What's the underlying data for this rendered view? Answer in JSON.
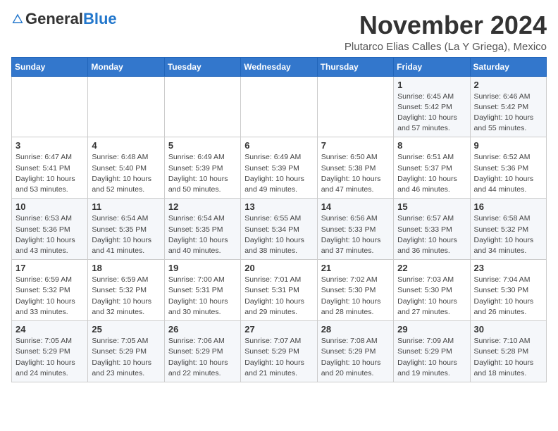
{
  "header": {
    "logo_general": "General",
    "logo_blue": "Blue",
    "month": "November 2024",
    "location": "Plutarco Elias Calles (La Y Griega), Mexico"
  },
  "days_of_week": [
    "Sunday",
    "Monday",
    "Tuesday",
    "Wednesday",
    "Thursday",
    "Friday",
    "Saturday"
  ],
  "weeks": [
    [
      {
        "day": "",
        "info": ""
      },
      {
        "day": "",
        "info": ""
      },
      {
        "day": "",
        "info": ""
      },
      {
        "day": "",
        "info": ""
      },
      {
        "day": "",
        "info": ""
      },
      {
        "day": "1",
        "info": "Sunrise: 6:45 AM\nSunset: 5:42 PM\nDaylight: 10 hours\nand 57 minutes."
      },
      {
        "day": "2",
        "info": "Sunrise: 6:46 AM\nSunset: 5:42 PM\nDaylight: 10 hours\nand 55 minutes."
      }
    ],
    [
      {
        "day": "3",
        "info": "Sunrise: 6:47 AM\nSunset: 5:41 PM\nDaylight: 10 hours\nand 53 minutes."
      },
      {
        "day": "4",
        "info": "Sunrise: 6:48 AM\nSunset: 5:40 PM\nDaylight: 10 hours\nand 52 minutes."
      },
      {
        "day": "5",
        "info": "Sunrise: 6:49 AM\nSunset: 5:39 PM\nDaylight: 10 hours\nand 50 minutes."
      },
      {
        "day": "6",
        "info": "Sunrise: 6:49 AM\nSunset: 5:39 PM\nDaylight: 10 hours\nand 49 minutes."
      },
      {
        "day": "7",
        "info": "Sunrise: 6:50 AM\nSunset: 5:38 PM\nDaylight: 10 hours\nand 47 minutes."
      },
      {
        "day": "8",
        "info": "Sunrise: 6:51 AM\nSunset: 5:37 PM\nDaylight: 10 hours\nand 46 minutes."
      },
      {
        "day": "9",
        "info": "Sunrise: 6:52 AM\nSunset: 5:36 PM\nDaylight: 10 hours\nand 44 minutes."
      }
    ],
    [
      {
        "day": "10",
        "info": "Sunrise: 6:53 AM\nSunset: 5:36 PM\nDaylight: 10 hours\nand 43 minutes."
      },
      {
        "day": "11",
        "info": "Sunrise: 6:54 AM\nSunset: 5:35 PM\nDaylight: 10 hours\nand 41 minutes."
      },
      {
        "day": "12",
        "info": "Sunrise: 6:54 AM\nSunset: 5:35 PM\nDaylight: 10 hours\nand 40 minutes."
      },
      {
        "day": "13",
        "info": "Sunrise: 6:55 AM\nSunset: 5:34 PM\nDaylight: 10 hours\nand 38 minutes."
      },
      {
        "day": "14",
        "info": "Sunrise: 6:56 AM\nSunset: 5:33 PM\nDaylight: 10 hours\nand 37 minutes."
      },
      {
        "day": "15",
        "info": "Sunrise: 6:57 AM\nSunset: 5:33 PM\nDaylight: 10 hours\nand 36 minutes."
      },
      {
        "day": "16",
        "info": "Sunrise: 6:58 AM\nSunset: 5:32 PM\nDaylight: 10 hours\nand 34 minutes."
      }
    ],
    [
      {
        "day": "17",
        "info": "Sunrise: 6:59 AM\nSunset: 5:32 PM\nDaylight: 10 hours\nand 33 minutes."
      },
      {
        "day": "18",
        "info": "Sunrise: 6:59 AM\nSunset: 5:32 PM\nDaylight: 10 hours\nand 32 minutes."
      },
      {
        "day": "19",
        "info": "Sunrise: 7:00 AM\nSunset: 5:31 PM\nDaylight: 10 hours\nand 30 minutes."
      },
      {
        "day": "20",
        "info": "Sunrise: 7:01 AM\nSunset: 5:31 PM\nDaylight: 10 hours\nand 29 minutes."
      },
      {
        "day": "21",
        "info": "Sunrise: 7:02 AM\nSunset: 5:30 PM\nDaylight: 10 hours\nand 28 minutes."
      },
      {
        "day": "22",
        "info": "Sunrise: 7:03 AM\nSunset: 5:30 PM\nDaylight: 10 hours\nand 27 minutes."
      },
      {
        "day": "23",
        "info": "Sunrise: 7:04 AM\nSunset: 5:30 PM\nDaylight: 10 hours\nand 26 minutes."
      }
    ],
    [
      {
        "day": "24",
        "info": "Sunrise: 7:05 AM\nSunset: 5:29 PM\nDaylight: 10 hours\nand 24 minutes."
      },
      {
        "day": "25",
        "info": "Sunrise: 7:05 AM\nSunset: 5:29 PM\nDaylight: 10 hours\nand 23 minutes."
      },
      {
        "day": "26",
        "info": "Sunrise: 7:06 AM\nSunset: 5:29 PM\nDaylight: 10 hours\nand 22 minutes."
      },
      {
        "day": "27",
        "info": "Sunrise: 7:07 AM\nSunset: 5:29 PM\nDaylight: 10 hours\nand 21 minutes."
      },
      {
        "day": "28",
        "info": "Sunrise: 7:08 AM\nSunset: 5:29 PM\nDaylight: 10 hours\nand 20 minutes."
      },
      {
        "day": "29",
        "info": "Sunrise: 7:09 AM\nSunset: 5:29 PM\nDaylight: 10 hours\nand 19 minutes."
      },
      {
        "day": "30",
        "info": "Sunrise: 7:10 AM\nSunset: 5:28 PM\nDaylight: 10 hours\nand 18 minutes."
      }
    ]
  ]
}
